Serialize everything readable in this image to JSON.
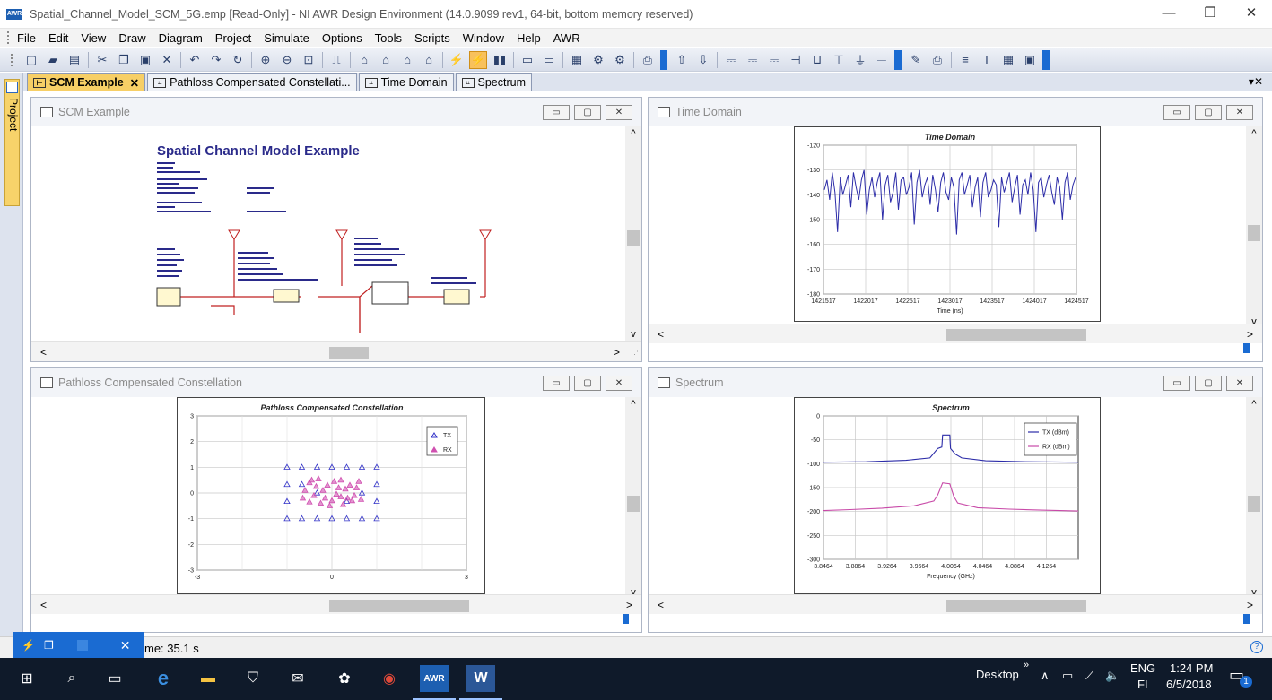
{
  "window": {
    "title": "Spatial_Channel_Model_SCM_5G.emp [Read-Only] - NI AWR Design Environment (14.0.9099 rev1, 64-bit, bottom memory reserved)",
    "logo": "AWR",
    "minimize": "—",
    "restore": "❐",
    "close": "✕"
  },
  "menu": [
    "File",
    "Edit",
    "View",
    "Draw",
    "Diagram",
    "Project",
    "Simulate",
    "Options",
    "Tools",
    "Scripts",
    "Window",
    "Help",
    "AWR"
  ],
  "toolbar_icons": [
    "new-icon",
    "open-icon",
    "save-icon",
    "cut-icon",
    "copy-icon",
    "paste-icon",
    "delete-icon",
    "undo-icon",
    "redo-icon",
    "rotate-icon",
    "zoom-area-icon",
    "zoom-out-icon",
    "view-all-icon",
    "add-schematic-icon",
    "add-system-diagram-icon",
    "add-graph-icon",
    "add-measurement-icon",
    "tune-icon",
    "simulate-icon",
    "stop-icon",
    "netlist-icon",
    "equation-icon",
    "text-icon",
    "element-icon",
    "load-icon",
    "source-icon",
    "port-icon",
    "subcircuit-icon",
    "tuner-icon",
    "ground-icon",
    "wire-icon",
    "print-icon",
    "text-tool-icon",
    "graph-icon",
    "layout-icon"
  ],
  "left_panel": {
    "project_label": "Project"
  },
  "tabs": [
    {
      "label": "SCM Example",
      "active": true
    },
    {
      "label": "Pathloss Compensated Constellati...",
      "active": false
    },
    {
      "label": "Time Domain",
      "active": false
    },
    {
      "label": "Spectrum",
      "active": false
    }
  ],
  "panes": {
    "scm": {
      "title": "SCM Example",
      "heading": "Spatial Channel Model Example",
      "buttons": [
        "▭",
        "▢",
        "✕"
      ]
    },
    "time": {
      "title": "Time Domain",
      "graph_title": "Time Domain",
      "xlabel": "Time (ns)",
      "buttons": [
        "▭",
        "▢",
        "✕"
      ]
    },
    "constellation": {
      "title": "Pathloss Compensated Constellation",
      "graph_title": "Pathloss Compensated Constellation",
      "buttons": [
        "▭",
        "▢",
        "✕"
      ]
    },
    "spectrum": {
      "title": "Spectrum",
      "graph_title": "Spectrum",
      "xlabel": "Frequency (GHz)",
      "buttons": [
        "▭",
        "▢",
        "✕"
      ]
    }
  },
  "chart_data": [
    {
      "type": "line",
      "title": "Time Domain",
      "xlabel": "Time (ns)",
      "ylabel": "",
      "xticks": [
        "1421517",
        "1422017",
        "1422517",
        "1423017",
        "1423517",
        "1424017",
        "1424517"
      ],
      "yticks": [
        "-120",
        "-130",
        "-140",
        "-150",
        "-160",
        "-170",
        "-180"
      ],
      "xlim": [
        1421517,
        1424817
      ],
      "ylim": [
        -180,
        -120
      ],
      "grid": true,
      "series": [
        {
          "values": [
            -138,
            -134,
            -142,
            -131,
            -139,
            -155,
            -133,
            -140,
            -136,
            -132,
            -145,
            -131,
            -137,
            -142,
            -134,
            -130,
            -148,
            -138,
            -133,
            -141,
            -135,
            -131,
            -150,
            -136,
            -132,
            -143,
            -139,
            -131,
            -146,
            -134,
            -133,
            -140,
            -137,
            -131,
            -152,
            -135,
            -130,
            -141,
            -136,
            -133,
            -144,
            -132,
            -138,
            -147,
            -135,
            -131,
            -139,
            -142,
            -133,
            -137,
            -156,
            -134,
            -131,
            -140,
            -136,
            -132,
            -145,
            -137,
            -133,
            -149,
            -135,
            -131,
            -141,
            -138,
            -134,
            -136,
            -153,
            -133,
            -139,
            -135,
            -131,
            -143,
            -137,
            -132,
            -148,
            -136,
            -134,
            -140,
            -131,
            -138,
            -155,
            -135,
            -133,
            -141,
            -136,
            -132,
            -139,
            -144,
            -133,
            -137,
            -150,
            -135,
            -131,
            -142,
            -136,
            -133
          ]
        }
      ]
    },
    {
      "type": "scatter",
      "title": "Pathloss Compensated Constellation",
      "xticks": [
        "-3",
        "0",
        "3"
      ],
      "yticks": [
        "3",
        "2",
        "1",
        "0",
        "-1",
        "-2",
        "-3"
      ],
      "xlim": [
        -3,
        3
      ],
      "ylim": [
        -3,
        3
      ],
      "grid": true,
      "legend": "top-right",
      "series": [
        {
          "name": "TX",
          "color": "#3232c8",
          "points": [
            [
              -1,
              1
            ],
            [
              -0.67,
              1
            ],
            [
              -0.33,
              1
            ],
            [
              0,
              1
            ],
            [
              0.33,
              1
            ],
            [
              0.67,
              1
            ],
            [
              1,
              1
            ],
            [
              -1,
              0.33
            ],
            [
              1,
              0.33
            ],
            [
              -1,
              -0.33
            ],
            [
              1,
              -0.33
            ],
            [
              -1,
              -1
            ],
            [
              -0.67,
              -1
            ],
            [
              -0.33,
              -1
            ],
            [
              0,
              -1
            ],
            [
              0.33,
              -1
            ],
            [
              0.67,
              -1
            ],
            [
              1,
              -1
            ],
            [
              -0.67,
              0.33
            ],
            [
              0.33,
              -0.33
            ],
            [
              -0.33,
              0
            ],
            [
              0.67,
              0
            ]
          ]
        },
        {
          "name": "RX",
          "color": "#d050b0",
          "points": [
            [
              -0.5,
              0.4
            ],
            [
              -0.3,
              0.55
            ],
            [
              -0.1,
              0.3
            ],
            [
              0.2,
              0.5
            ],
            [
              0.4,
              0.3
            ],
            [
              0.6,
              0.45
            ],
            [
              -0.6,
              0.1
            ],
            [
              -0.4,
              -0.1
            ],
            [
              -0.2,
              0.1
            ],
            [
              0.1,
              -0.05
            ],
            [
              0.3,
              0.15
            ],
            [
              0.5,
              -0.1
            ],
            [
              -0.5,
              -0.35
            ],
            [
              -0.25,
              -0.4
            ],
            [
              0,
              -0.3
            ],
            [
              0.25,
              -0.45
            ],
            [
              0.45,
              -0.3
            ],
            [
              -0.35,
              0.25
            ],
            [
              0.05,
              0.45
            ],
            [
              0.35,
              -0.2
            ],
            [
              -0.15,
              -0.2
            ],
            [
              0.15,
              0.2
            ],
            [
              -0.45,
              0.5
            ],
            [
              0.55,
              0.2
            ],
            [
              -0.05,
              -0.5
            ],
            [
              0.65,
              -0.25
            ],
            [
              -0.65,
              -0.2
            ],
            [
              0.2,
              -0.15
            ]
          ]
        }
      ]
    },
    {
      "type": "line",
      "title": "Spectrum",
      "xlabel": "Frequency (GHz)",
      "xticks": [
        "3.8464",
        "3.8864",
        "3.9264",
        "3.9664",
        "4.0064",
        "4.0464",
        "4.0864",
        "4.1264"
      ],
      "yticks": [
        "0",
        "-50",
        "-100",
        "-150",
        "-200",
        "-250",
        "-300"
      ],
      "xlim": [
        3.8464,
        4.1664
      ],
      "ylim": [
        -300,
        0
      ],
      "grid": true,
      "legend": "top-right",
      "series": [
        {
          "name": "TX (dBm)",
          "color": "#2c2ca8",
          "x": [
            3.8464,
            3.9,
            3.95,
            3.98,
            3.99,
            3.995,
            3.996,
            4.005,
            4.006,
            4.012,
            4.02,
            4.05,
            4.1,
            4.1664
          ],
          "values": [
            -97,
            -96,
            -93,
            -88,
            -68,
            -65,
            -40,
            -40,
            -68,
            -80,
            -88,
            -94,
            -96,
            -97
          ]
        },
        {
          "name": "RX (dBm)",
          "color": "#c84aa8",
          "x": [
            3.8464,
            3.88,
            3.92,
            3.96,
            3.985,
            3.99,
            3.996,
            4.005,
            4.01,
            4.015,
            4.04,
            4.08,
            4.12,
            4.1664
          ],
          "values": [
            -198,
            -196,
            -193,
            -188,
            -178,
            -165,
            -140,
            -142,
            -168,
            -182,
            -192,
            -195,
            -197,
            -199
          ]
        }
      ]
    }
  ],
  "status": {
    "text": "me: 35.1 s",
    "help": "?"
  },
  "notify": {
    "icon": "⚡",
    "label": ""
  },
  "taskbar": {
    "desktop": "Desktop",
    "lang": "ENG",
    "region": "FI",
    "time": "1:24 PM",
    "date": "6/5/2018",
    "badge": "1",
    "awr_label": "AWR",
    "word_label": "W",
    "chevron": "»",
    "tray_up": "∧",
    "battery": "▭",
    "network": "⟋",
    "volume": "🔈"
  }
}
